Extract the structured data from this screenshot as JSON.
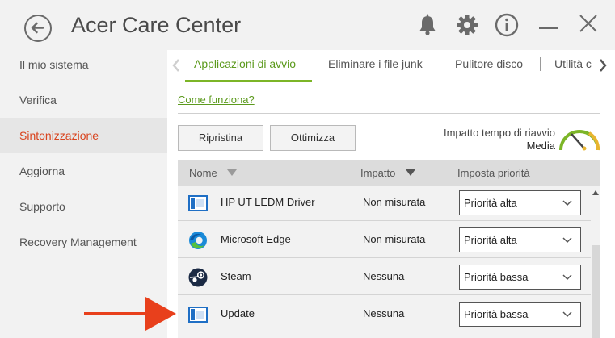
{
  "window": {
    "title": "Acer Care Center"
  },
  "titlebar_icons": {
    "back": "back-arrow-icon",
    "notifications": "bell-icon",
    "settings": "gear-icon",
    "info": "info-icon",
    "minimize": "minimize-icon",
    "close": "close-icon"
  },
  "sidebar": {
    "items": [
      {
        "label": "Il mio sistema",
        "active": false
      },
      {
        "label": "Verifica",
        "active": false
      },
      {
        "label": "Sintonizzazione",
        "active": true
      },
      {
        "label": "Aggiorna",
        "active": false
      },
      {
        "label": "Supporto",
        "active": false
      },
      {
        "label": "Recovery Management",
        "active": false
      }
    ]
  },
  "tabs": [
    {
      "label": "Applicazioni di avvio",
      "active": true
    },
    {
      "label": "Eliminare i file junk",
      "active": false
    },
    {
      "label": "Pulitore disco",
      "active": false
    },
    {
      "label": "Utilità c",
      "active": false
    }
  ],
  "content": {
    "how_link": "Come funziona?",
    "buttons": {
      "reset": "Ripristina",
      "optimize": "Ottimizza"
    },
    "restart_impact": {
      "label": "Impatto tempo di riavvio",
      "value": "Media"
    }
  },
  "table": {
    "columns": {
      "name": "Nome",
      "impact": "Impatto",
      "priority": "Imposta priorità"
    },
    "rows": [
      {
        "name": "HP UT LEDM Driver",
        "impact": "Non misurata",
        "priority": "Priorità alta",
        "icon": "app-window-icon"
      },
      {
        "name": "Microsoft Edge",
        "impact": "Non misurata",
        "priority": "Priorità alta",
        "icon": "edge-icon"
      },
      {
        "name": "Steam",
        "impact": "Nessuna",
        "priority": "Priorità bassa",
        "icon": "steam-icon"
      },
      {
        "name": "Update",
        "impact": "Nessuna",
        "priority": "Priorità bassa",
        "icon": "app-window-icon"
      }
    ]
  },
  "colors": {
    "accent_green": "#7cb527",
    "active_sidebar_text": "#d9441f",
    "annotation_arrow": "#e8401c"
  }
}
